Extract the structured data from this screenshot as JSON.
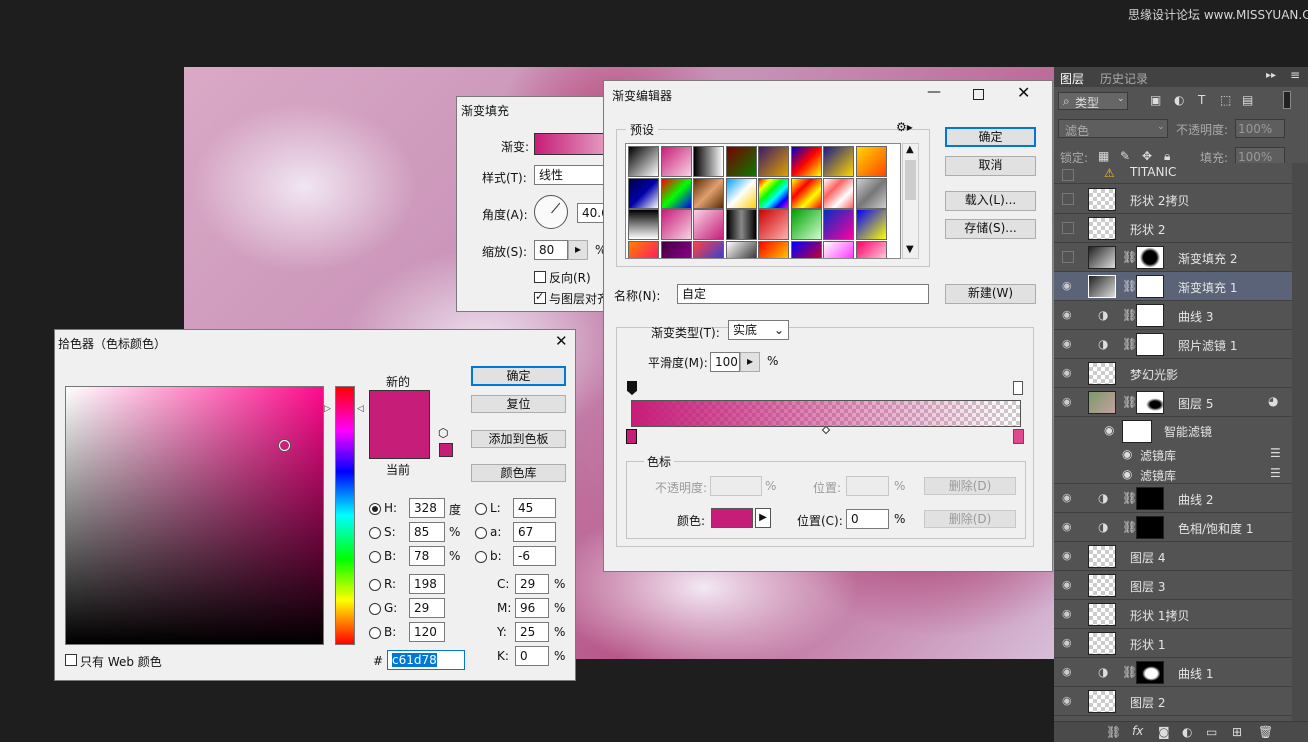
{
  "watermark": "思缘设计论坛 www.MISSYUAN.COM",
  "gradient_fill": {
    "title": "渐变填充",
    "gradient_label": "渐变:",
    "style_label": "样式(T):",
    "style_value": "线性",
    "angle_label": "角度(A):",
    "angle_value": "40.6",
    "scale_label": "缩放(S):",
    "scale_value": "80",
    "scale_unit": "%",
    "reverse_label": "反向(R)",
    "align_label": "与图层对齐"
  },
  "gradient_editor": {
    "title": "渐变编辑器",
    "presets_label": "预设",
    "ok": "确定",
    "cancel": "取消",
    "load": "载入(L)...",
    "save": "存储(S)...",
    "name_label": "名称(N):",
    "name_value": "自定",
    "new_button": "新建(W)",
    "type_label": "渐变类型(T):",
    "type_value": "实底",
    "smooth_label": "平滑度(M):",
    "smooth_value": "100",
    "smooth_unit": "%",
    "stops_label": "色标",
    "opacity_label": "不透明度:",
    "opacity_unit": "%",
    "position_label_disabled": "位置:",
    "position_unit_disabled": "%",
    "delete1": "删除(D)",
    "color_label": "颜色:",
    "position_label": "位置(C):",
    "position_value": "0",
    "position_unit": "%",
    "delete2": "删除(D)",
    "stop_color": "#c61d78"
  },
  "color_picker": {
    "title": "拾色器（色标颜色）",
    "new_label": "新的",
    "current_label": "当前",
    "ok": "确定",
    "reset": "复位",
    "add_swatch": "添加到色板",
    "libraries": "颜色库",
    "web_only": "只有 Web 颜色",
    "H_label": "H:",
    "H": "328",
    "H_unit": "度",
    "S_label": "S:",
    "S": "85",
    "S_unit": "%",
    "Bv_label": "B:",
    "Bv": "78",
    "Bv_unit": "%",
    "R_label": "R:",
    "R": "198",
    "G_label": "G:",
    "G": "29",
    "Bl_label": "B:",
    "Bl": "120",
    "L_label": "L:",
    "L": "45",
    "a_label": "a:",
    "a": "67",
    "b_label": "b:",
    "b": "-6",
    "C_label": "C:",
    "C": "29",
    "C_unit": "%",
    "M_label": "M:",
    "M": "96",
    "M_unit": "%",
    "Y_label": "Y:",
    "Y": "25",
    "Y_unit": "%",
    "K_label": "K:",
    "K": "0",
    "K_unit": "%",
    "hash": "#",
    "hex": "c61d78",
    "color": "#c61d78"
  },
  "layers_panel": {
    "tab_layers": "图层",
    "tab_history": "历史记录",
    "filter_kind": "类型",
    "blend_mode": "滤色",
    "opacity_label": "不透明度:",
    "opacity_value": "100%",
    "lock_label": "锁定:",
    "fill_label": "填充:",
    "fill_value": "100%",
    "layers": [
      {
        "name": "TITANIC"
      },
      {
        "name": "形状 2拷贝"
      },
      {
        "name": "形状 2"
      },
      {
        "name": "渐变填充 2"
      },
      {
        "name": "渐变填充 1"
      },
      {
        "name": "曲线 3"
      },
      {
        "name": "照片滤镜 1"
      },
      {
        "name": "梦幻光影"
      },
      {
        "name": "图层 5"
      },
      {
        "name": "智能滤镜"
      },
      {
        "name": "滤镜库"
      },
      {
        "name": "滤镜库"
      },
      {
        "name": "曲线 2"
      },
      {
        "name": "色相/饱和度 1"
      },
      {
        "name": "图层 4"
      },
      {
        "name": "图层 3"
      },
      {
        "name": "形状 1拷贝"
      },
      {
        "name": "形状 1"
      },
      {
        "name": "曲线 1"
      },
      {
        "name": "图层 2"
      }
    ]
  }
}
